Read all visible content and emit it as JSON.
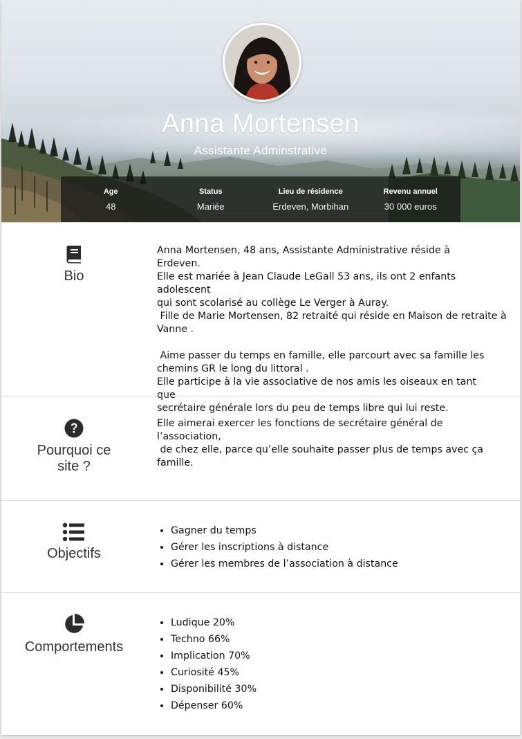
{
  "profile": {
    "name": "Anna Mortensen",
    "role": "Assistante Adminstrative"
  },
  "stats": [
    {
      "label": "Age",
      "value": "48"
    },
    {
      "label": "Status",
      "value": "Mariée"
    },
    {
      "label": "Lieu de résidence",
      "value": "Erdeven, Morbihan"
    },
    {
      "label": "Revenu annuel",
      "value": "30 000 euros"
    }
  ],
  "bio": {
    "title": "Bio",
    "icon": "book-icon",
    "lines": [
      "Anna Mortensen, 48 ans, Assistante Administrative réside à Erdeven.",
      "Elle est mariée à Jean Claude LeGall 53 ans, ils ont 2 enfants adolescent",
      "qui sont scolarisé au collège Le Verger à Auray.",
      " Fille de Marie Mortensen, 82 retraité qui réside en Maison de retraite à",
      "Vanne .",
      "",
      " Aime passer du temps en famille, elle parcourt avec sa famille les",
      "chemins GR le long du littoral .",
      "Elle participe à la vie associative de nos amis les oiseaux en tant que",
      "secrétaire générale lors du peu de temps libre qui lui reste."
    ]
  },
  "pourquoi": {
    "title_line1": "Pourquoi ce",
    "title_line2": "site ?",
    "icon": "question-circle-icon",
    "lines": [
      "Elle aimerai exercer les fonctions de secrétaire général de l’association,",
      " de chez elle, parce qu’elle souhaite passer plus de temps avec ça",
      "famille."
    ]
  },
  "objectifs": {
    "title": "Objectifs",
    "icon": "list-icon",
    "items": [
      "Gagner du temps",
      "Gérer les inscriptions à distance",
      "Gérer les membres de l’association à distance"
    ]
  },
  "comportements": {
    "title": "Comportements",
    "icon": "pie-chart-icon",
    "items": [
      "Ludique 20%",
      "Techno 66%",
      "Implication 70%",
      "Curiosité 45%",
      "Disponibilité 30%",
      "Dépenser 60%"
    ]
  }
}
